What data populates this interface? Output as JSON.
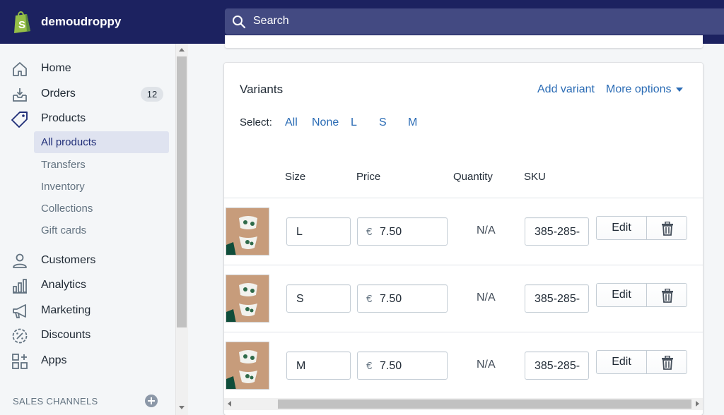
{
  "store": {
    "name": "demoudroppy"
  },
  "search": {
    "placeholder": "Search"
  },
  "sidebar": {
    "items": [
      {
        "label": "Home",
        "icon": "home-icon"
      },
      {
        "label": "Orders",
        "icon": "orders-icon",
        "badge": "12"
      },
      {
        "label": "Products",
        "icon": "tag-icon"
      },
      {
        "label": "Customers",
        "icon": "person-icon"
      },
      {
        "label": "Analytics",
        "icon": "bar-chart-icon"
      },
      {
        "label": "Marketing",
        "icon": "megaphone-icon"
      },
      {
        "label": "Discounts",
        "icon": "discount-icon"
      },
      {
        "label": "Apps",
        "icon": "apps-icon"
      }
    ],
    "subitems": [
      {
        "label": "All products",
        "active": true
      },
      {
        "label": "Transfers"
      },
      {
        "label": "Inventory"
      },
      {
        "label": "Collections"
      },
      {
        "label": "Gift cards"
      }
    ],
    "sales_channels": "SALES CHANNELS"
  },
  "variants": {
    "title": "Variants",
    "add_variant": "Add variant",
    "more_options": "More options",
    "select_label": "Select:",
    "select_links": [
      "All",
      "None",
      "L",
      "S",
      "M"
    ],
    "columns": {
      "size": "Size",
      "price": "Price",
      "quantity": "Quantity",
      "sku": "SKU"
    },
    "rows": [
      {
        "size": "L",
        "currency": "€",
        "price": "7.50",
        "quantity": "N/A",
        "sku": "385-285-",
        "edit": "Edit"
      },
      {
        "size": "S",
        "currency": "€",
        "price": "7.50",
        "quantity": "N/A",
        "sku": "385-285-",
        "edit": "Edit"
      },
      {
        "size": "M",
        "currency": "€",
        "price": "7.50",
        "quantity": "N/A",
        "sku": "385-285-",
        "edit": "Edit"
      }
    ]
  },
  "colors": {
    "topbar": "#1c2260",
    "link": "#2b6cb5",
    "active_bg": "#dfe3f0"
  }
}
